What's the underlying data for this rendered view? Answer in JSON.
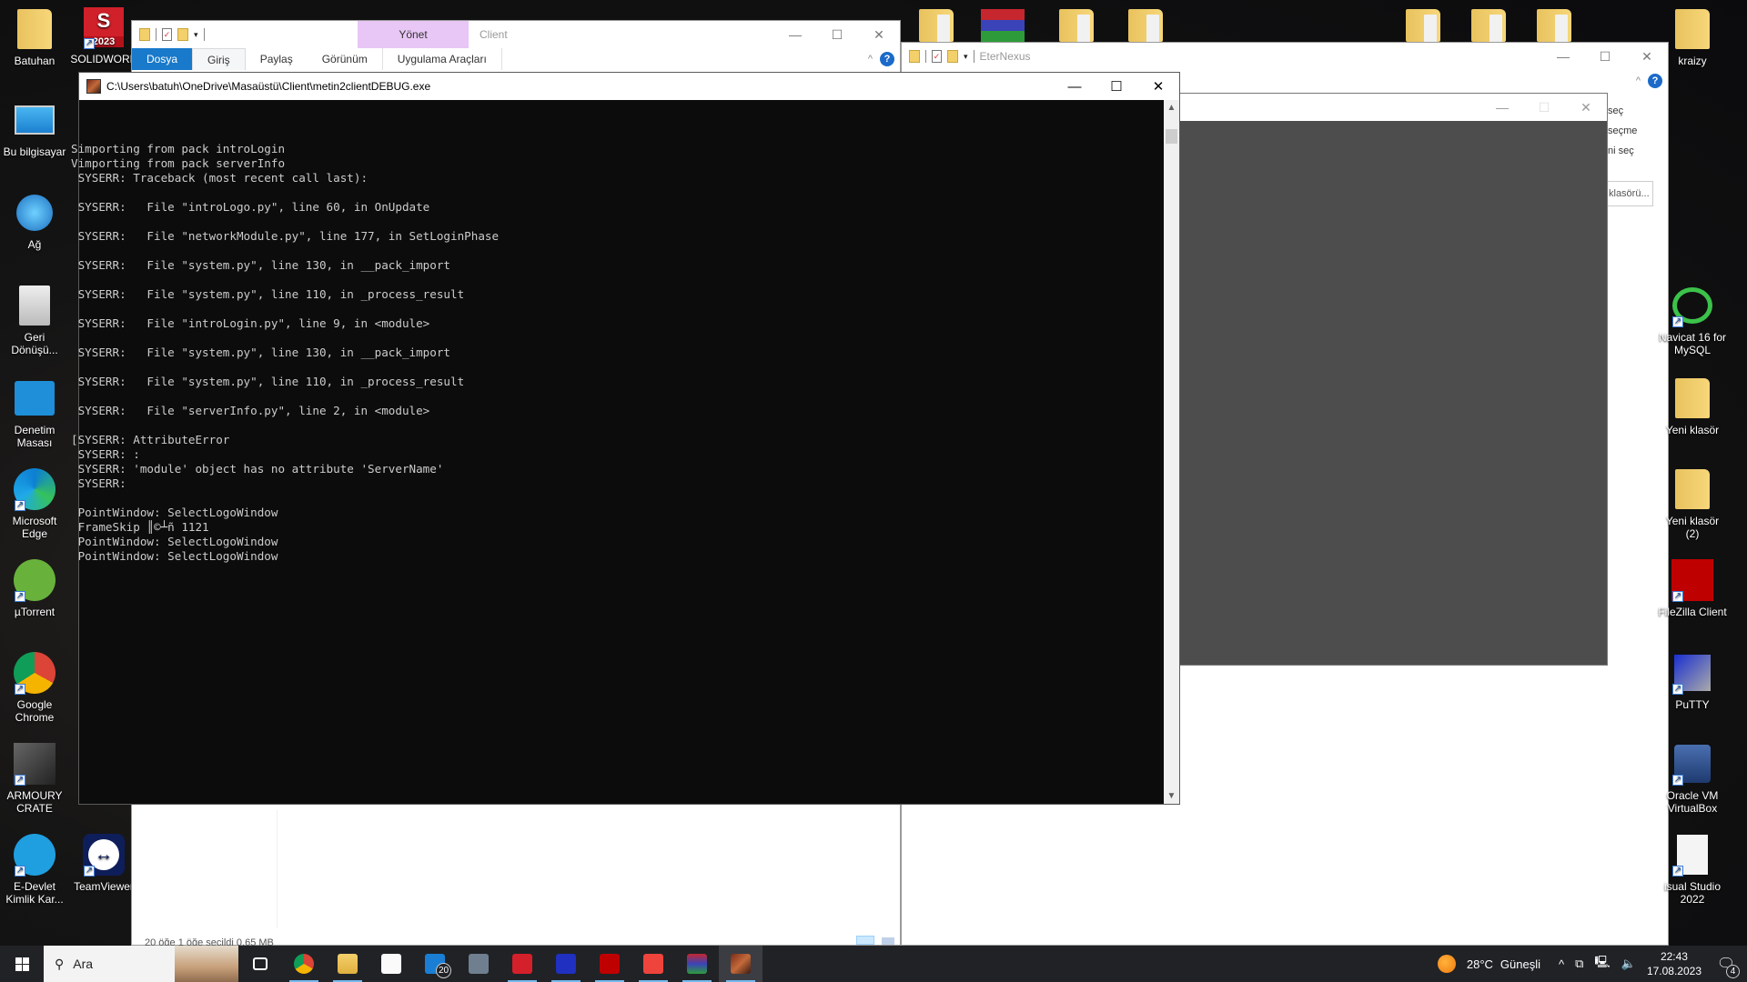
{
  "desktop": {
    "left_icons": [
      {
        "label": "Batuhan",
        "icon": "user-folder-icon"
      },
      {
        "label": "Bu bilgisayar",
        "icon": "computer-icon"
      },
      {
        "label": "Ağ",
        "icon": "network-icon"
      },
      {
        "label": "Geri Dönüşü...",
        "icon": "recycle-bin-icon"
      },
      {
        "label": "Denetim Masası",
        "icon": "control-panel-icon"
      },
      {
        "label": "Microsoft Edge",
        "icon": "edge-icon"
      },
      {
        "label": "µTorrent",
        "icon": "utorrent-icon"
      },
      {
        "label": "Google Chrome",
        "icon": "chrome-icon"
      },
      {
        "label": "ARMOURY CRATE",
        "icon": "armoury-crate-icon"
      },
      {
        "label": "E-Devlet Kimlik Kar...",
        "icon": "edevlet-icon"
      }
    ],
    "second_col_icons": [
      {
        "label": "SOLIDWORK",
        "icon": "solidworks-icon",
        "badge": "2023"
      },
      {
        "label": "TeamViewer",
        "icon": "teamviewer-icon"
      }
    ],
    "right_icons": [
      {
        "label": "kraizy",
        "icon": "folder-icon"
      },
      {
        "label": "Navicat 16 for MySQL",
        "icon": "navicat-icon"
      },
      {
        "label": "Yeni klasör",
        "icon": "folder-icon"
      },
      {
        "label": "Yeni klasör (2)",
        "icon": "folder-icon"
      },
      {
        "label": "FileZilla Client",
        "icon": "filezilla-icon"
      },
      {
        "label": "PuTTY",
        "icon": "putty-icon"
      },
      {
        "label": "Oracle VM VirtualBox",
        "icon": "virtualbox-icon"
      },
      {
        "label": "isual Studio 2022",
        "icon": "file-icon"
      }
    ]
  },
  "explorer_client": {
    "title": "Client",
    "context_tab": "Yönet",
    "tabs": [
      "Dosya",
      "Giriş",
      "Paylaş",
      "Görünüm",
      "Uygulama Araçları"
    ],
    "help": "?",
    "status": "20 öğe   1 öğe seçildi 0,65 MB"
  },
  "explorer_eternexus": {
    "title": "EterNexus",
    "side_items": [
      "seç",
      "seçme",
      "ni seç"
    ],
    "button": "klasörü...",
    "help": "?"
  },
  "console": {
    "title": "C:\\Users\\batuh\\OneDrive\\Masaüstü\\Client\\metin2clientDEBUG.exe",
    "lines": [
      "Simporting from pack introLogin",
      "Vimporting from pack serverInfo",
      " SYSERR: Traceback (most recent call last):",
      "",
      " SYSERR:   File \"introLogo.py\", line 60, in OnUpdate",
      "",
      " SYSERR:   File \"networkModule.py\", line 177, in SetLoginPhase",
      "",
      " SYSERR:   File \"system.py\", line 130, in __pack_import",
      "",
      " SYSERR:   File \"system.py\", line 110, in _process_result",
      "",
      " SYSERR:   File \"introLogin.py\", line 9, in <module>",
      "",
      " SYSERR:   File \"system.py\", line 130, in __pack_import",
      "",
      " SYSERR:   File \"system.py\", line 110, in _process_result",
      "",
      " SYSERR:   File \"serverInfo.py\", line 2, in <module>",
      "",
      "[SYSERR: AttributeError",
      " SYSERR: :",
      " SYSERR: 'module' object has no attribute 'ServerName'",
      " SYSERR:",
      "",
      " PointWindow: SelectLogoWindow",
      " FrameSkip ║©┴ñ 1121",
      " PointWindow: SelectLogoWindow",
      " PointWindow: SelectLogoWindow"
    ]
  },
  "taskbar": {
    "search_placeholder": "Ara",
    "apps": [
      {
        "name": "task-view",
        "running": false
      },
      {
        "name": "chrome",
        "running": true
      },
      {
        "name": "file-explorer",
        "running": true
      },
      {
        "name": "microsoft-store",
        "running": false
      },
      {
        "name": "mail",
        "running": false,
        "badge": "20"
      },
      {
        "name": "calculator",
        "running": false
      },
      {
        "name": "acrobat",
        "running": true
      },
      {
        "name": "network-tool",
        "running": true
      },
      {
        "name": "filezilla",
        "running": true
      },
      {
        "name": "anydesk",
        "running": true
      },
      {
        "name": "winrar",
        "running": true
      },
      {
        "name": "metin2",
        "running": true,
        "active": true
      }
    ],
    "weather_temp": "28°C",
    "weather_text": "Güneşli",
    "time": "22:43",
    "date": "17.08.2023",
    "notifications": "4"
  }
}
